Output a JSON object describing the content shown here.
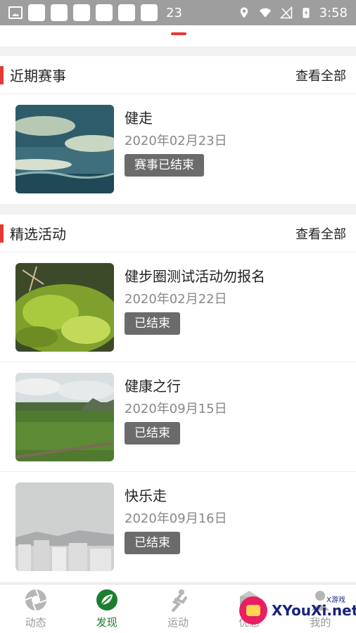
{
  "statusbar": {
    "notification_count": "23",
    "time": "3:58"
  },
  "sections": [
    {
      "title": "近期赛事",
      "more": "查看全部",
      "items": [
        {
          "title": "健走",
          "date": "2020年02月23日",
          "badge": "赛事已结束"
        }
      ]
    },
    {
      "title": "精选活动",
      "more": "查看全部",
      "items": [
        {
          "title": "健步圈测试活动勿报名",
          "date": "2020年02月22日",
          "badge": "已结束"
        },
        {
          "title": "健康之行",
          "date": "2020年09月15日",
          "badge": "已结束"
        },
        {
          "title": "快乐走",
          "date": "2020年09月16日",
          "badge": "已结束"
        }
      ]
    }
  ],
  "bottomnav": {
    "items": [
      {
        "label": "动态",
        "icon": "aperture-icon"
      },
      {
        "label": "发现",
        "icon": "leaf-icon"
      },
      {
        "label": "运动",
        "icon": "runner-icon"
      },
      {
        "label": "优惠",
        "icon": "gift-icon"
      },
      {
        "label": "我的",
        "icon": "person-icon"
      }
    ],
    "active_index": 1
  },
  "watermark": {
    "text": "XYouXi.net",
    "small": "X游戏"
  },
  "colors": {
    "accent": "#e53935",
    "nav_active": "#1a7f2e",
    "badge_bg": "#6b6b6b"
  }
}
